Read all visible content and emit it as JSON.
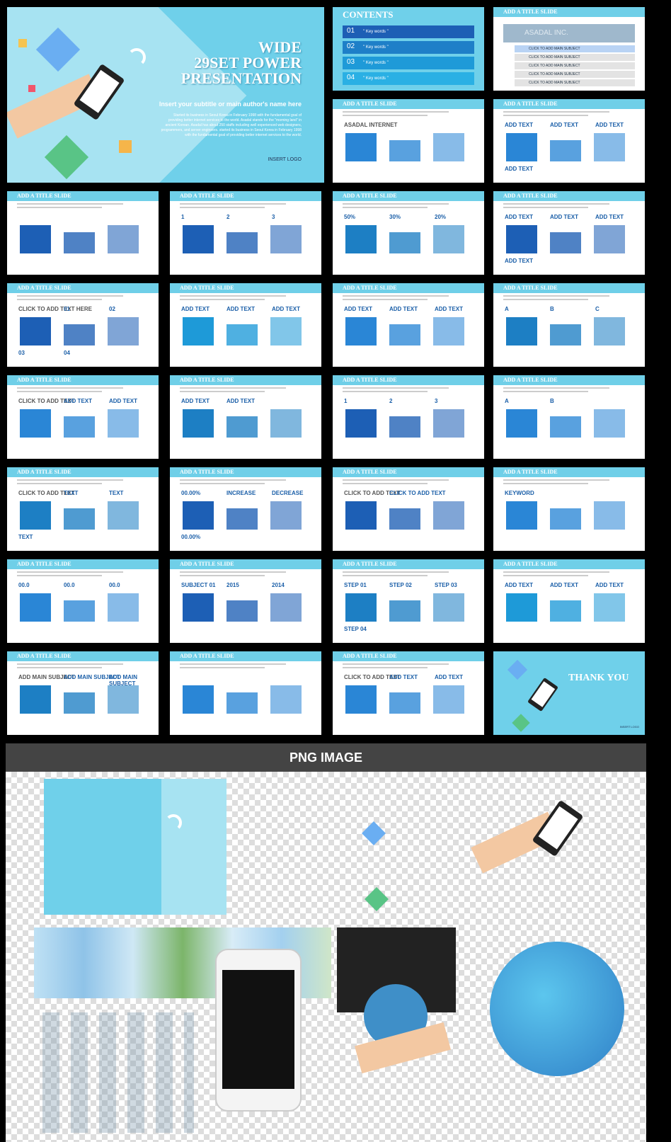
{
  "hero": {
    "title_lines": [
      "WIDE",
      "29SET POWER",
      "PRESENTATION"
    ],
    "subtitle": "Insert your subtitle or main author's name here",
    "description": "Started its business in Seoul Korea in February 1998 with the fundamental goal of providing better internet services to the world. Asadal stands for the \"morning land\" in ancient Korean. Asadal has about 250 staffs including well experienced web designers, programmers, and server engineers. started its business in Seoul Korea in February 1998 with the fundamental goal of providing better internet services to the world.",
    "logo": "INSERT LOGO"
  },
  "contents_slide": {
    "title": "CONTENTS",
    "items": [
      {
        "num": "01",
        "keyword": "\" Key words \""
      },
      {
        "num": "02",
        "keyword": "\" Key words \""
      },
      {
        "num": "03",
        "keyword": "\" Key words \""
      },
      {
        "num": "04",
        "keyword": "\" Key words \""
      }
    ]
  },
  "slide_title": "ADD A TITLE SLIDE",
  "subject_slide": {
    "brand": "ASADAL INC.",
    "items": [
      "CLICK TO ADD MAIN SUBJECT",
      "CLICK TO ADD MAIN SUBJECT",
      "CLICK TO ADD MAIN SUBJECT",
      "CLICK TO ADD MAIN SUBJECT",
      "CLICK TO ADD MAIN SUBJECT"
    ]
  },
  "slides": [
    {
      "labels": [
        "ASADAL INTERNET"
      ],
      "color": "#2a86d6"
    },
    {
      "labels": [
        "ADD TEXT",
        "ADD TEXT",
        "ADD TEXT",
        "ADD TEXT"
      ],
      "color": "#2a86d6"
    },
    {
      "labels": [],
      "color": "#1d5fb5"
    },
    {
      "labels": [
        "1",
        "2",
        "3"
      ],
      "color": "#1d5fb5"
    },
    {
      "labels": [
        "50%",
        "30%",
        "20%"
      ],
      "color": "#1d7fc4"
    },
    {
      "labels": [
        "ADD TEXT",
        "ADD TEXT",
        "ADD TEXT",
        "ADD TEXT"
      ],
      "color": "#1d5fb5"
    },
    {
      "labels": [
        "CLICK TO ADD TEXT HERE",
        "01",
        "02",
        "03",
        "04"
      ],
      "color": "#1d5fb5"
    },
    {
      "labels": [
        "ADD TEXT",
        "ADD TEXT",
        "ADD TEXT"
      ],
      "color": "#1e9ad8"
    },
    {
      "labels": [
        "ADD TEXT",
        "ADD TEXT",
        "ADD TEXT"
      ],
      "color": "#2a86d6"
    },
    {
      "labels": [
        "A",
        "B",
        "C"
      ],
      "color": "#1d7fc4"
    },
    {
      "labels": [
        "CLICK TO ADD TEXT",
        "ADD TEXT",
        "ADD TEXT"
      ],
      "color": "#2a86d6"
    },
    {
      "labels": [
        "ADD TEXT",
        "ADD TEXT"
      ],
      "color": "#1d7fc4"
    },
    {
      "labels": [
        "1",
        "2",
        "3"
      ],
      "color": "#1d5fb5"
    },
    {
      "labels": [
        "A",
        "B"
      ],
      "color": "#2a86d6"
    },
    {
      "labels": [
        "CLICK TO ADD TEXT",
        "TEXT",
        "TEXT",
        "TEXT"
      ],
      "color": "#1d7fc4"
    },
    {
      "labels": [
        "00.00%",
        "INCREASE",
        "DECREASE",
        "00.00%"
      ],
      "color": "#1d5fb5"
    },
    {
      "labels": [
        "CLICK TO ADD TEXT",
        "CLICK TO ADD TEXT"
      ],
      "color": "#1d5fb5"
    },
    {
      "labels": [
        "KEYWORD"
      ],
      "color": "#2a86d6"
    },
    {
      "labels": [
        "00.0",
        "00.0",
        "00.0"
      ],
      "color": "#2a86d6"
    },
    {
      "labels": [
        "SUBJECT 01",
        "2015",
        "2014"
      ],
      "color": "#1d5fb5"
    },
    {
      "labels": [
        "STEP 01",
        "STEP 02",
        "STEP 03",
        "STEP 04"
      ],
      "color": "#1d7fc4"
    },
    {
      "labels": [
        "ADD TEXT",
        "ADD TEXT",
        "ADD TEXT"
      ],
      "color": "#1e9ad8"
    },
    {
      "labels": [
        "ADD MAIN SUBJECT",
        "ADD MAIN SUBJECT",
        "ADD MAIN SUBJECT"
      ],
      "color": "#1d7fc4"
    },
    {
      "labels": [],
      "color": "#2a86d6"
    },
    {
      "labels": [
        "CLICK TO ADD TEXT",
        "ADD TEXT",
        "ADD TEXT"
      ],
      "color": "#2a86d6"
    }
  ],
  "thank_you": {
    "title": "THANK YOU",
    "logo": "INSERT LOGO"
  },
  "png_section": {
    "title": "PNG IMAGE"
  },
  "watermark": "asadal.com",
  "colors": {
    "sky": "#6fd0ea",
    "banner": "#444444",
    "blue": "#2a86d6"
  }
}
